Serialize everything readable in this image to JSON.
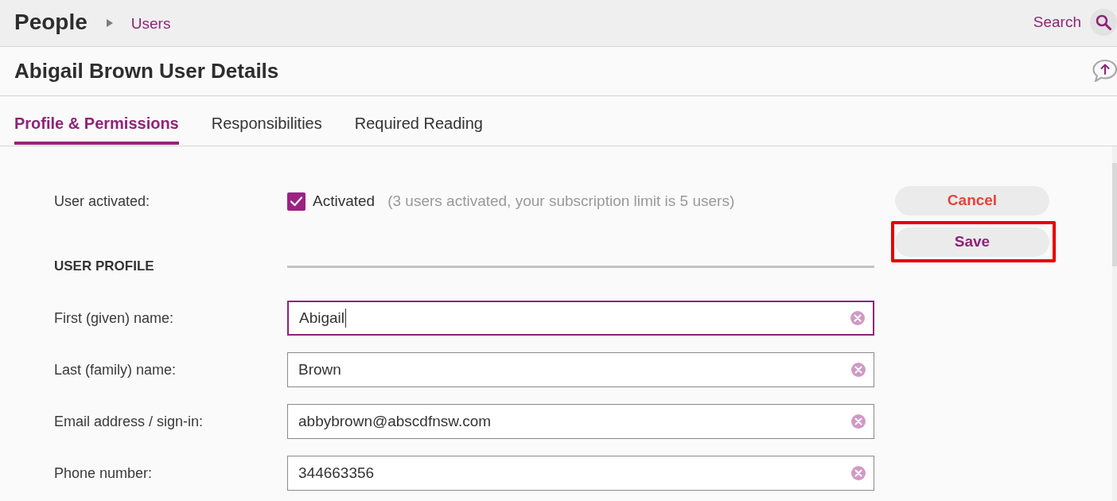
{
  "breadcrumb": {
    "title": "People",
    "link": "Users"
  },
  "search": {
    "label": "Search"
  },
  "page": {
    "title": "Abigail Brown User Details"
  },
  "tabs": [
    {
      "label": "Profile & Permissions",
      "selected": true
    },
    {
      "label": "Responsibilities",
      "selected": false
    },
    {
      "label": "Required Reading",
      "selected": false
    }
  ],
  "activation": {
    "label": "User activated:",
    "checked": true,
    "checkbox_label": "Activated",
    "note": "(3 users activated, your subscription limit is 5 users)"
  },
  "buttons": [
    {
      "label": "Cancel",
      "kind": "cancel",
      "highlighted": false
    },
    {
      "label": "Save",
      "kind": "save",
      "highlighted": true
    }
  ],
  "section": {
    "heading": "USER PROFILE"
  },
  "fields": [
    {
      "label": "First (given) name:",
      "value": "Abigail",
      "focused": true
    },
    {
      "label": "Last (family) name:",
      "value": "Brown",
      "focused": false
    },
    {
      "label": "Email address / sign-in:",
      "value": "abbybrown@abscdfnsw.com",
      "focused": false
    },
    {
      "label": "Phone number:",
      "value": "344663356",
      "focused": false
    }
  ]
}
